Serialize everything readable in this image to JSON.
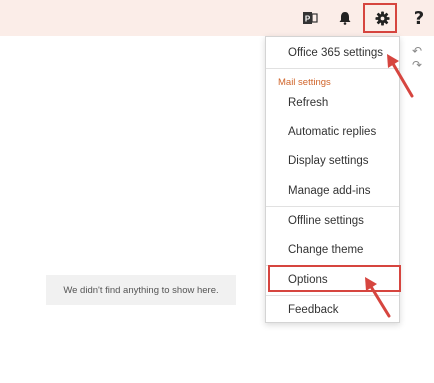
{
  "topbar": {
    "icons": [
      "people-icon",
      "bell-icon",
      "gear-icon",
      "help-icon"
    ],
    "help_label": "?",
    "background": "#fbede8"
  },
  "menu": {
    "office_settings": "Office 365 settings",
    "mail_section": "Mail settings",
    "items": [
      "Refresh",
      "Automatic replies",
      "Display settings",
      "Manage add-ins"
    ],
    "offline_settings": "Offline settings",
    "change_theme": "Change theme",
    "options": "Options",
    "feedback": "Feedback"
  },
  "main": {
    "empty_message": "We didn't find anything to show here."
  },
  "colors": {
    "highlight": "#d6453f",
    "section_label": "#d0642a"
  }
}
